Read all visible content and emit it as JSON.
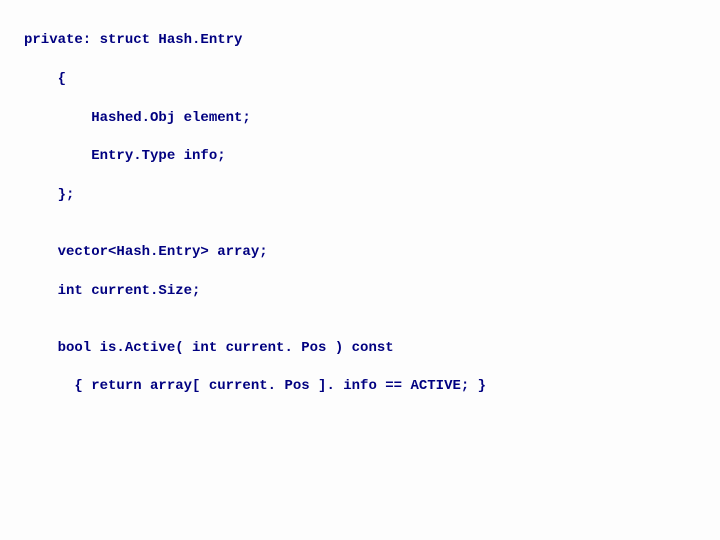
{
  "code": {
    "l1": "private: struct Hash.Entry",
    "l2": "    {",
    "l3": "        Hashed.Obj element;",
    "l4": "        Entry.Type info;",
    "l5": "    };",
    "l6": "    vector<Hash.Entry> array;",
    "l7": "    int current.Size;",
    "l8": "    bool is.Active( int current. Pos ) const",
    "l9": "      { return array[ current. Pos ]. info == ACTIVE; }"
  }
}
